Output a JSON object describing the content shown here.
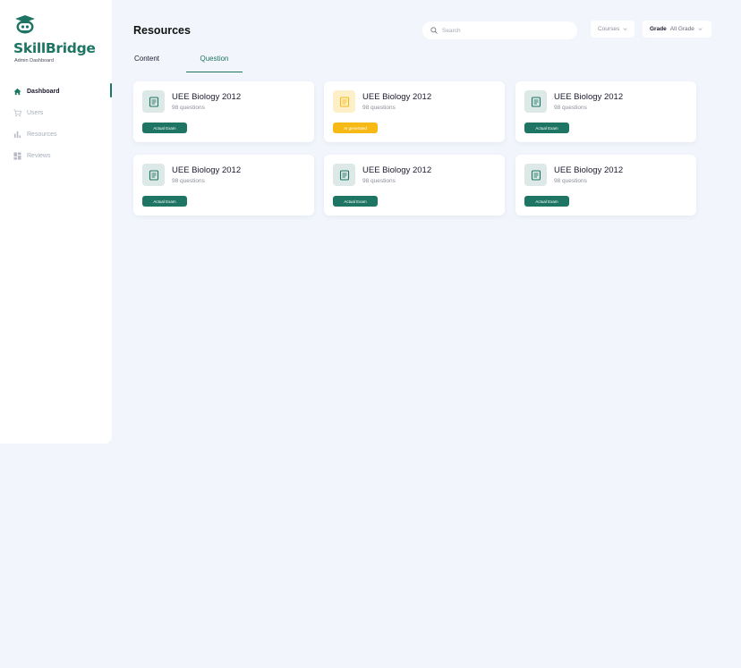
{
  "brand": {
    "name": "SkillBridge",
    "subtitle": "Admin Dashboard"
  },
  "sidebar": {
    "items": [
      {
        "label": "Dashboard",
        "icon": "home-icon",
        "active": true
      },
      {
        "label": "Users",
        "icon": "cart-icon",
        "active": false
      },
      {
        "label": "Resources",
        "icon": "bar-chart-icon",
        "active": false
      },
      {
        "label": "Reviews",
        "icon": "dashboard-grid-icon",
        "active": false
      }
    ]
  },
  "header": {
    "title": "Resources",
    "search": {
      "placeholder": "Search",
      "value": ""
    },
    "courses_filter": {
      "label": "Courses"
    },
    "grade_filter": {
      "label": "Grade",
      "value": "All Grade"
    }
  },
  "tabs": [
    {
      "label": "Content",
      "active": false
    },
    {
      "label": "Question",
      "active": true
    }
  ],
  "colors": {
    "accent": "#1e7563",
    "warning": "#f6b915",
    "background": "#f2f6fc"
  },
  "cards": [
    {
      "title": "UEE Biology 2012",
      "subtitle": "98 questions",
      "badge": "Actual Exam",
      "variant": "green"
    },
    {
      "title": "UEE Biology 2012",
      "subtitle": "98 questions",
      "badge": "AI generated",
      "variant": "yellow"
    },
    {
      "title": "UEE Biology 2012",
      "subtitle": "98 questions",
      "badge": "Actual Exam",
      "variant": "green"
    },
    {
      "title": "UEE Biology 2012",
      "subtitle": "98 questions",
      "badge": "Actual Exam",
      "variant": "green"
    },
    {
      "title": "UEE Biology 2012",
      "subtitle": "98 questions",
      "badge": "Actual Exam",
      "variant": "green"
    },
    {
      "title": "UEE Biology 2012",
      "subtitle": "98 questions",
      "badge": "Actual Exam",
      "variant": "green"
    }
  ]
}
